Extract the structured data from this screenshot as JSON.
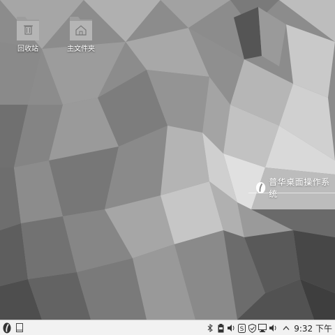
{
  "desktop": {
    "icons": [
      {
        "label": "回收站",
        "icon": "trash-icon"
      },
      {
        "label": "主文件夹",
        "icon": "home-folder-icon"
      }
    ],
    "brand_text": "普华桌面操作系统"
  },
  "taskbar": {
    "start_icon": "start-menu-logo-icon",
    "show_desktop_icon": "show-desktop-icon",
    "tray_icons": [
      "bluetooth-icon",
      "battery-icon",
      "volume-icon",
      "software-store-icon",
      "security-shield-icon",
      "network-monitor-icon",
      "speaker-icon",
      "chevron-up-icon"
    ],
    "clock": "9:32 下午"
  },
  "colors": {
    "taskbar_bg": "#f2f2f2",
    "wallpaper_base": "#8a8a8a",
    "brand_accent": "#ffffff"
  }
}
